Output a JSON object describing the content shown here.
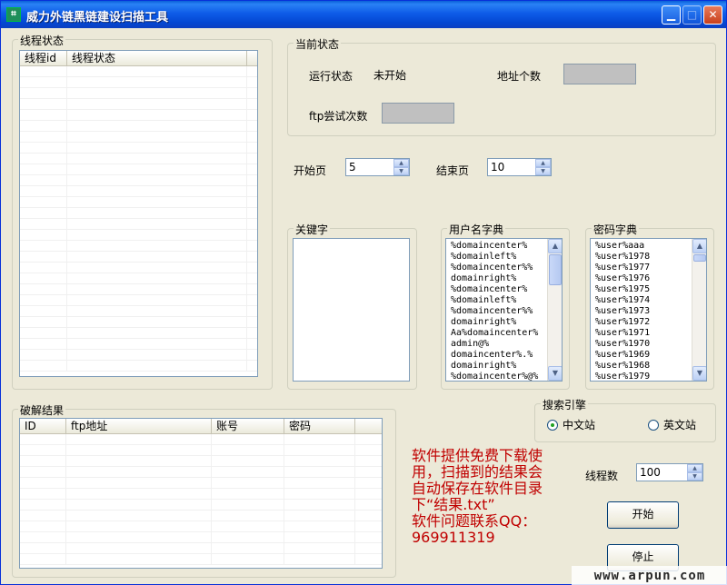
{
  "window": {
    "title": "威力外链黑链建设扫描工具"
  },
  "thread_status": {
    "legend": "线程状态",
    "columns": [
      "线程id",
      "线程状态"
    ]
  },
  "current_status": {
    "legend": "当前状态",
    "run_status_label": "运行状态",
    "run_status_value": "未开始",
    "address_count_label": "地址个数",
    "ftp_attempts_label": "ftp尝试次数"
  },
  "pages": {
    "start_label": "开始页",
    "start_value": "5",
    "end_label": "结束页",
    "end_value": "10"
  },
  "keywords": {
    "legend": "关键字"
  },
  "username_dict": {
    "legend": "用户名字典",
    "lines": "%domaincenter%\n%domainleft%\n%domaincenter%%\ndomainright%\n%domaincenter%\n%domainleft%\n%domaincenter%%\ndomainright%\nAa%domaincenter%\nadmin@%\ndomaincenter%.%\ndomainright%\n%domaincenter%@%"
  },
  "password_dict": {
    "legend": "密码字典",
    "lines": "%user%aaa\n%user%1978\n%user%1977\n%user%1976\n%user%1975\n%user%1974\n%user%1973\n%user%1972\n%user%1971\n%user%1970\n%user%1969\n%user%1968\n%user%1979"
  },
  "crack_results": {
    "legend": "破解结果",
    "columns": [
      "ID",
      "ftp地址",
      "账号",
      "密码"
    ]
  },
  "search_engine": {
    "legend": "搜索引擎",
    "option_cn": "中文站",
    "option_en": "英文站",
    "selected": "中文站"
  },
  "notice": {
    "line1": "软件提供免费下载使",
    "line2": "用，扫描到的结果会",
    "line3": "自动保存在软件目录",
    "line4": "下“结果.txt”",
    "line5": "软件问题联系QQ：",
    "line6": "969911319"
  },
  "threads": {
    "label": "线程数",
    "value": "100"
  },
  "buttons": {
    "start": "开始",
    "stop": "停止"
  },
  "watermark": "www.arpun.com",
  "colors": {
    "title_bar": "#0a5fd8",
    "notice": "#c00000",
    "background": "#ece9d8"
  }
}
